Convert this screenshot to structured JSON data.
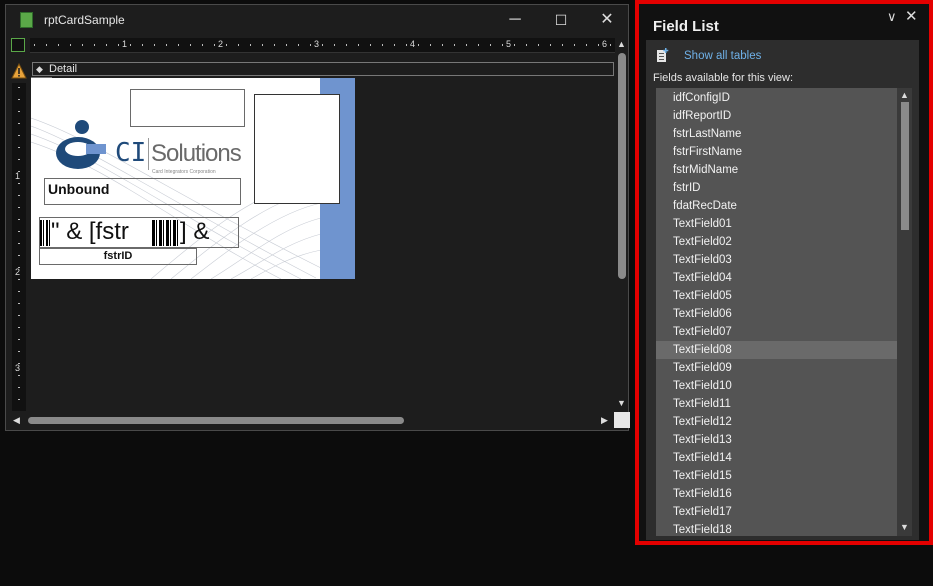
{
  "window": {
    "title": "rptCardSample",
    "minimize": "─",
    "maximize": "☐",
    "close": "✕"
  },
  "ruler": {
    "top_labels": [
      "1",
      "2",
      "3",
      "4",
      "5",
      "6"
    ],
    "left_labels": [
      "1",
      "2",
      "3"
    ]
  },
  "section": {
    "detail_label": "Detail"
  },
  "card": {
    "logo_ci": "CI",
    "logo_solutions": "Solutions",
    "logo_sub": "Card Integrators Corporation",
    "unbound_label": "Unbound",
    "barcode_text": "\" & [fstr",
    "barcode_tail": "] &",
    "id_field": "fstrID"
  },
  "field_list": {
    "title": "Field List",
    "show_all_tables": "Show all tables",
    "fields_label": "Fields available for this view:",
    "selected_index": 14,
    "fields": [
      "idfConfigID",
      "idfReportID",
      "fstrLastName",
      "fstrFirstName",
      "fstrMidName",
      "fstrID",
      "fdatRecDate",
      "TextField01",
      "TextField02",
      "TextField03",
      "TextField04",
      "TextField05",
      "TextField06",
      "TextField07",
      "TextField08",
      "TextField09",
      "TextField10",
      "TextField11",
      "TextField12",
      "TextField13",
      "TextField14",
      "TextField15",
      "TextField16",
      "TextField17",
      "TextField18"
    ]
  },
  "colors": {
    "highlight_border": "#e40000",
    "accent_blue": "#6fb1e8",
    "card_stripe": "#6f94cf",
    "logo_blue": "#1f4a7a"
  }
}
